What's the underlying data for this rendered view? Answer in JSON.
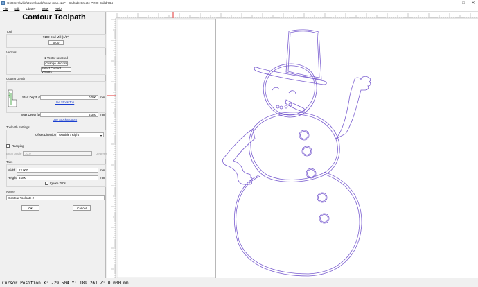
{
  "window": {
    "title": "C:\\Users\\willa\\Downloads\\snow man.c2d* - Carbide Create PRO: Build 764"
  },
  "menu": [
    "File",
    "Edit",
    "Library",
    "View",
    "Help"
  ],
  "panel": {
    "title": "Contour Toolpath",
    "tool": {
      "label": "Tool",
      "name": "#102 End Mill (1/8\")",
      "button": "0.00"
    },
    "vectors": {
      "label": "Vectors",
      "selected": "1 Vector selected",
      "change_button": "Change Vectors",
      "select_current_button": "Select Current Vectors"
    },
    "cutting_depth": {
      "label": "Cutting Depth",
      "start_label": "Start Depth (S):",
      "start_value": "0.000",
      "start_unit": "mm",
      "use_stock_top": "Use Stock Top",
      "max_label": "Max Depth (D):",
      "max_value": "6.350",
      "max_unit": "mm",
      "use_stock_bottom": "Use Stock Bottom"
    },
    "toolpath_settings": {
      "label": "Toolpath Settings",
      "offset_label": "Offset Direction",
      "offset_value": "Outside / Right",
      "ramping_label": "Ramping",
      "ramping_checked": false,
      "entry_angle_label": "Entry Angle",
      "entry_angle_value": "10.0",
      "entry_angle_unit": "Degrees"
    },
    "tabs": {
      "label": "Tabs",
      "width_label": "Width",
      "width_value": "12.000",
      "width_unit": "mm",
      "height_label": "Height",
      "height_value": "3.000",
      "height_unit": "mm",
      "ignore_label": "Ignore Tabs",
      "ignore_checked": false
    },
    "name": {
      "label": "Name",
      "value": "Contour Toolpath 2"
    },
    "ok_button": "Ok",
    "cancel_button": "Cancel"
  },
  "canvas": {
    "drawing": "snowman"
  },
  "status": {
    "text": "Cursor Position X: -29.504 Y: 189.261 Z: 0.000 mm"
  },
  "colors": {
    "vector": "#7b5fd0",
    "guide_red": "#e03030",
    "link": "#1a3fd0"
  }
}
